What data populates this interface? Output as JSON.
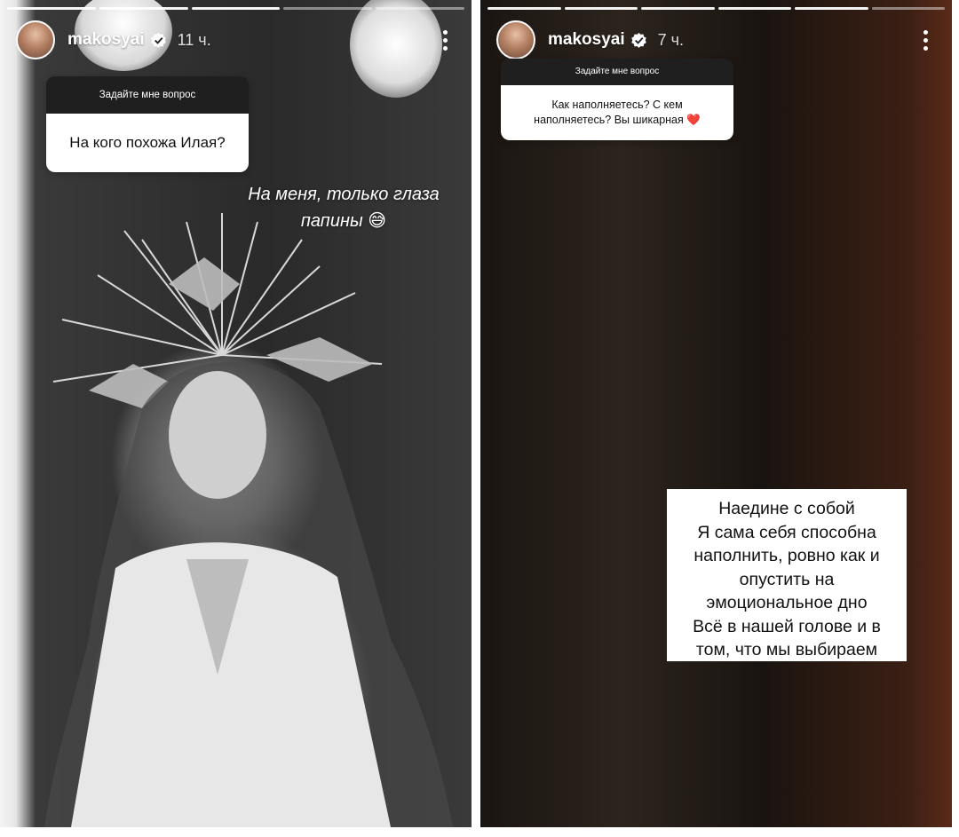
{
  "stories": [
    {
      "username": "makosyai",
      "time": "11 ч.",
      "question_header": "Задайте мне вопрос",
      "question": "На кого похожа Илая?",
      "answer_lines": [
        "На меня, только глаза",
        "папины 😅"
      ]
    },
    {
      "username": "makosyai",
      "time": "7 ч.",
      "question_header": "Задайте мне вопрос",
      "question_lines": [
        "Как наполняетесь? С кем",
        "наполняетесь? Вы шикарная ❤️"
      ],
      "answer_lines": [
        "Наедине с собой",
        "Я сама себя способна",
        "наполнить, ровно как и",
        "опустить на",
        "эмоциональное дно",
        "Всё в нашей голове и в",
        "том, что мы выбираем"
      ]
    }
  ],
  "colors": {
    "verified_badge": "#ffffff",
    "sticker_header_bg": "#1f1f1f",
    "heart": "#e0245e"
  },
  "icons": {
    "verified": "verified-badge-icon",
    "more": "more-options-icon"
  }
}
